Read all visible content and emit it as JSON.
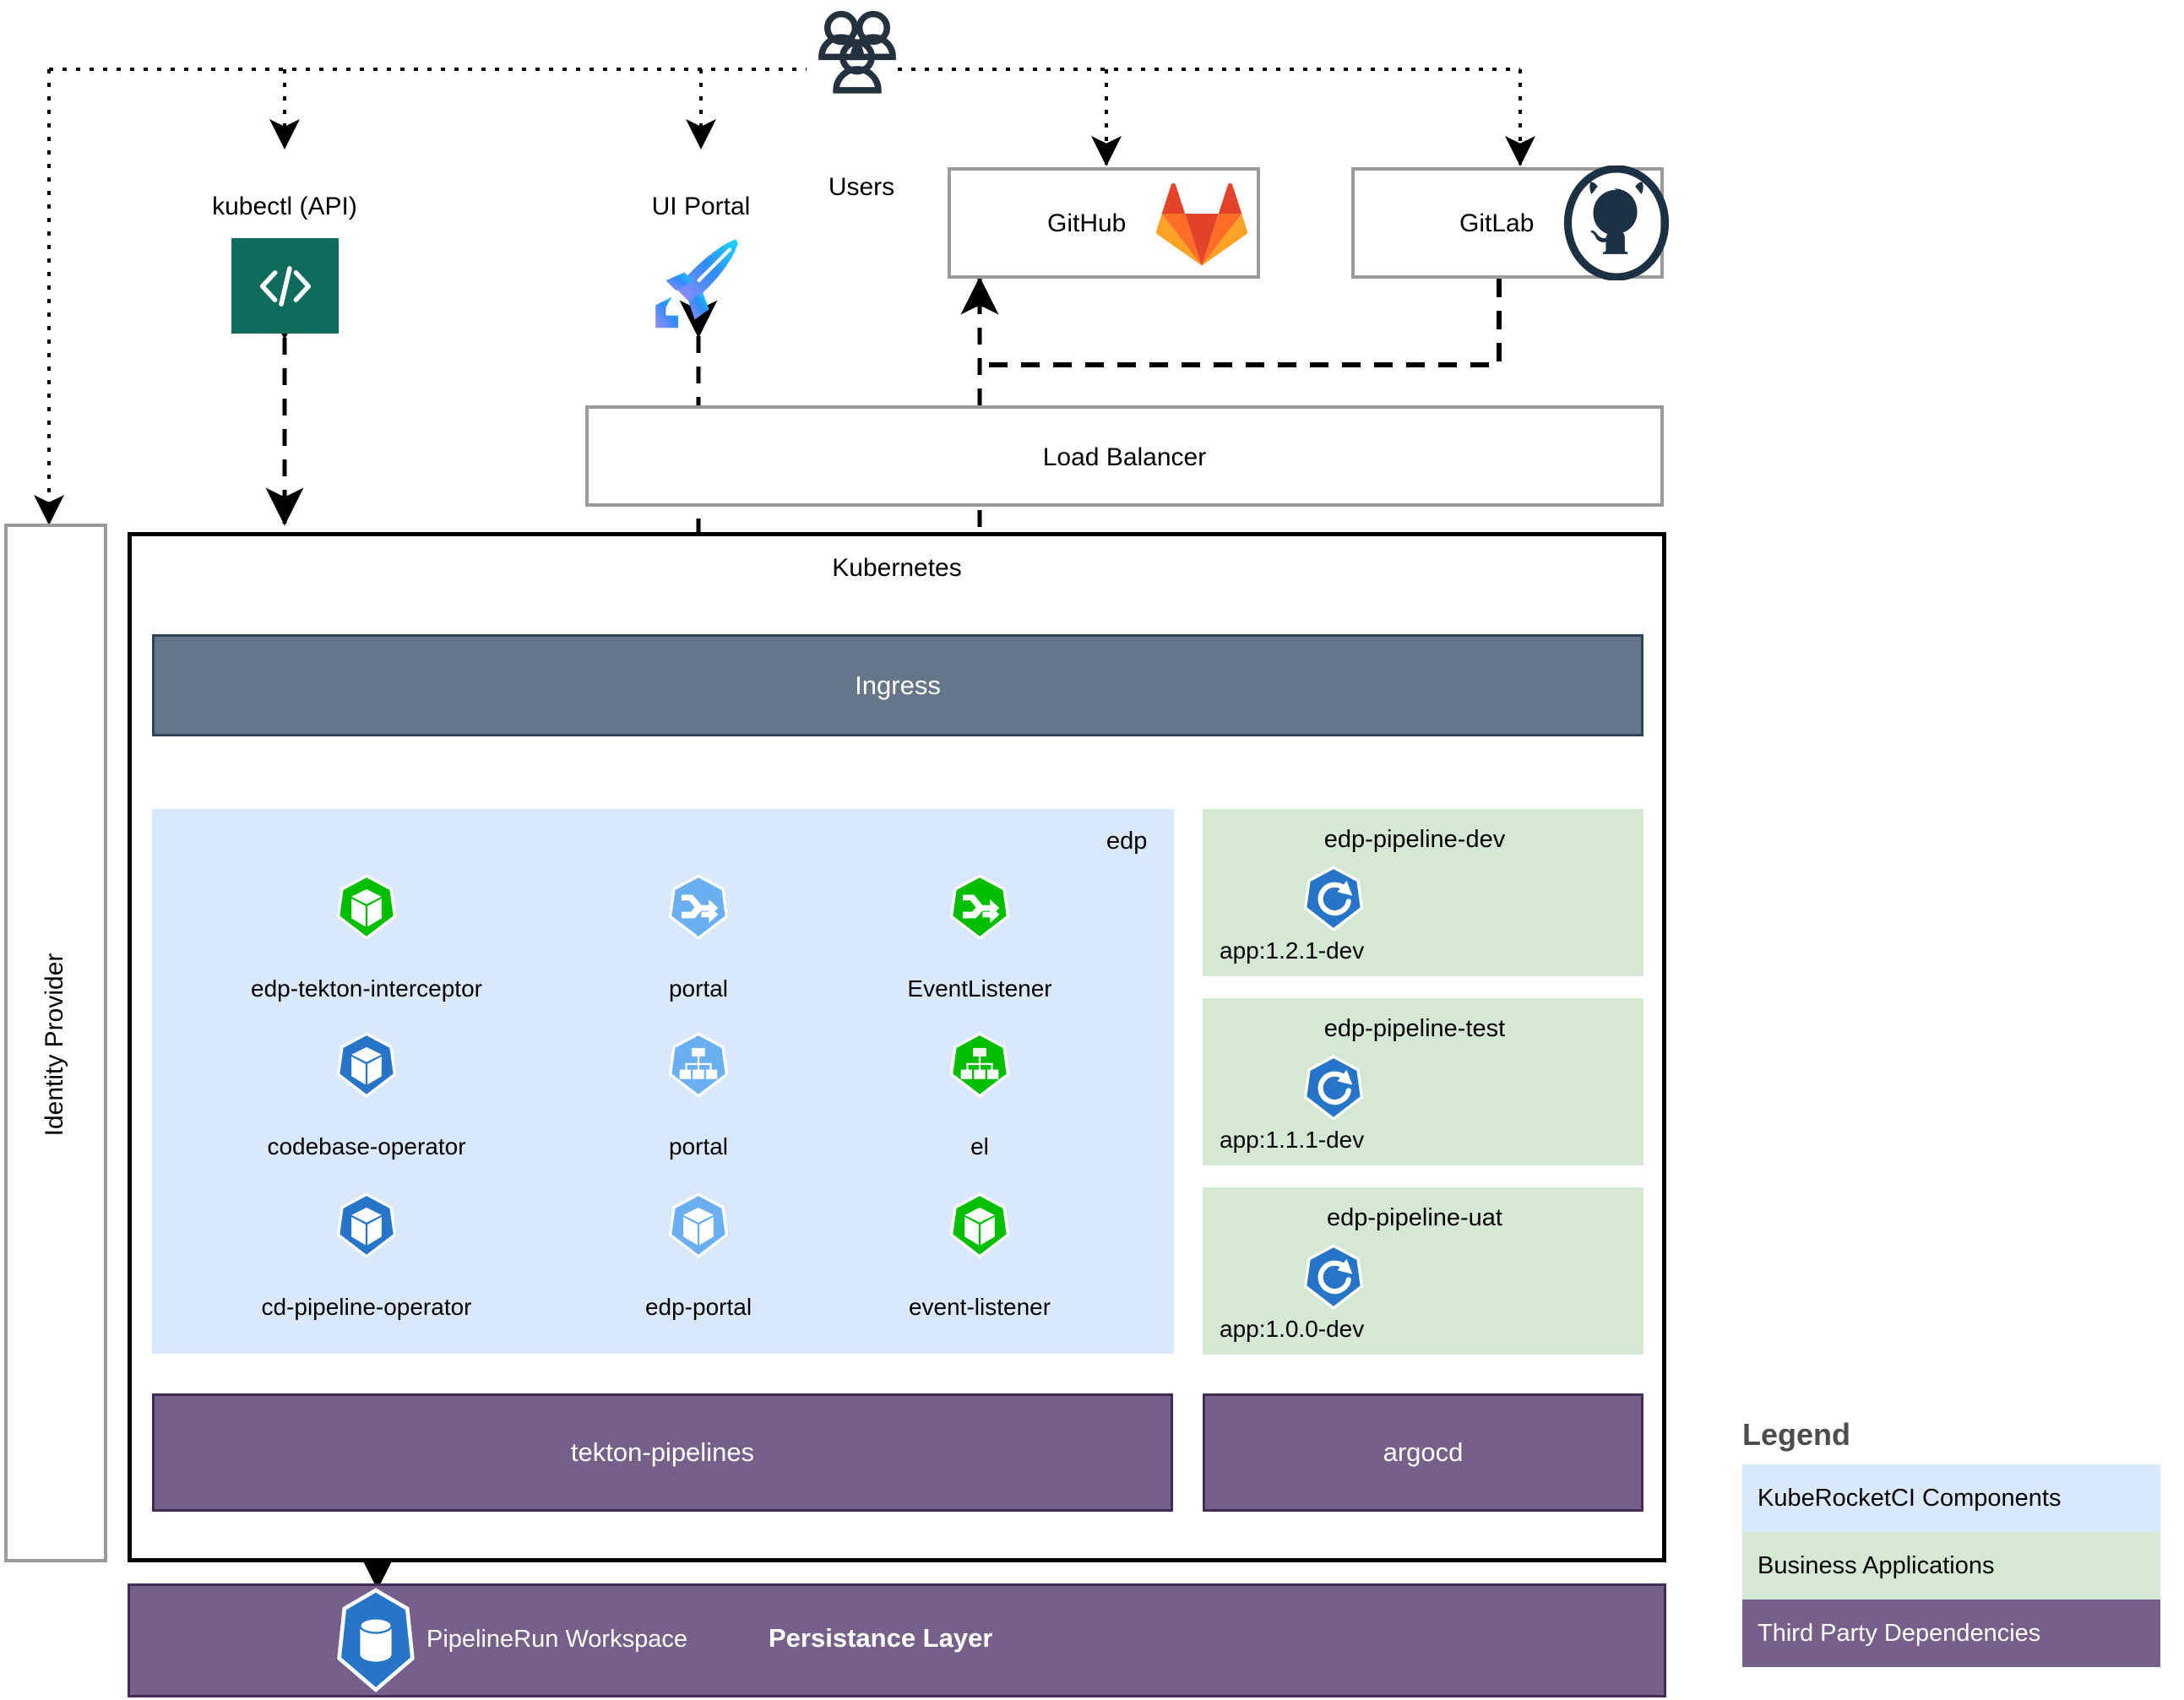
{
  "actors": {
    "users_label": "Users",
    "users_icon": "users-group-icon"
  },
  "clients": [
    {
      "label": "kubectl (API)",
      "icon": "code-brackets-icon"
    },
    {
      "label": "UI Portal",
      "icon": "rocket-icon"
    }
  ],
  "vcs": [
    {
      "label": "GitHub",
      "icon": "gitlab-fox-icon"
    },
    {
      "label": "GitLab",
      "icon": "github-octocat-icon"
    }
  ],
  "identity_provider": {
    "label": "Identity Provider"
  },
  "load_balancer": {
    "label": "Load Balancer"
  },
  "kubernetes": {
    "label": "Kubernetes",
    "ingress": {
      "label": "Ingress"
    },
    "edp_namespace": {
      "label": "edp",
      "components": [
        {
          "label": "edp-tekton-interceptor",
          "icon": "k8s-deployment-icon",
          "color": "#00bf00"
        },
        {
          "label": "portal",
          "icon": "k8s-ingress-icon",
          "color": "#6aafef"
        },
        {
          "label": "EventListener",
          "icon": "k8s-ingress-icon",
          "color": "#00bf00"
        },
        {
          "label": "codebase-operator",
          "icon": "k8s-deployment-icon",
          "color": "#2775c9"
        },
        {
          "label": "portal",
          "icon": "k8s-service-icon",
          "color": "#6aafef"
        },
        {
          "label": "el",
          "icon": "k8s-service-icon",
          "color": "#00bf00"
        },
        {
          "label": "cd-pipeline-operator",
          "icon": "k8s-deployment-icon",
          "color": "#2775c9"
        },
        {
          "label": "edp-portal",
          "icon": "k8s-deployment-icon",
          "color": "#6aafef"
        },
        {
          "label": "event-listener",
          "icon": "k8s-deployment-icon",
          "color": "#00bf00"
        }
      ]
    },
    "pipeline_namespaces": [
      {
        "label": "edp-pipeline-dev",
        "app": "app:1.2.1-dev",
        "icon": "k8s-replicaset-icon"
      },
      {
        "label": "edp-pipeline-test",
        "app": "app:1.1.1-dev",
        "icon": "k8s-replicaset-icon"
      },
      {
        "label": "edp-pipeline-uat",
        "app": "app:1.0.0-dev",
        "icon": "k8s-replicaset-icon"
      }
    ],
    "third_party": [
      {
        "label": "tekton-pipelines"
      },
      {
        "label": "argocd"
      }
    ]
  },
  "persistence": {
    "label": "Persistance Layer",
    "workspace_label": "PipelineRun Workspace",
    "workspace_icon": "k8s-pvc-icon"
  },
  "legend": {
    "title": "Legend",
    "items": [
      {
        "label": "KubeRocketCI Components",
        "color": "#dae8fc",
        "text_color": "#000000"
      },
      {
        "label": "Business Applications",
        "color": "#d5e8d4",
        "text_color": "#000000"
      },
      {
        "label": "Third Party Dependencies",
        "color": "#76608a",
        "text_color": "#ffffff"
      }
    ]
  },
  "colors": {
    "krci_blue": "#dae8fc",
    "business_green": "#d5e8d4",
    "third_party_purple": "#76608a",
    "ingress_slate": "#647687",
    "kubectl_teal": "#0f6b5c",
    "border_grey": "#9a9a9a"
  }
}
